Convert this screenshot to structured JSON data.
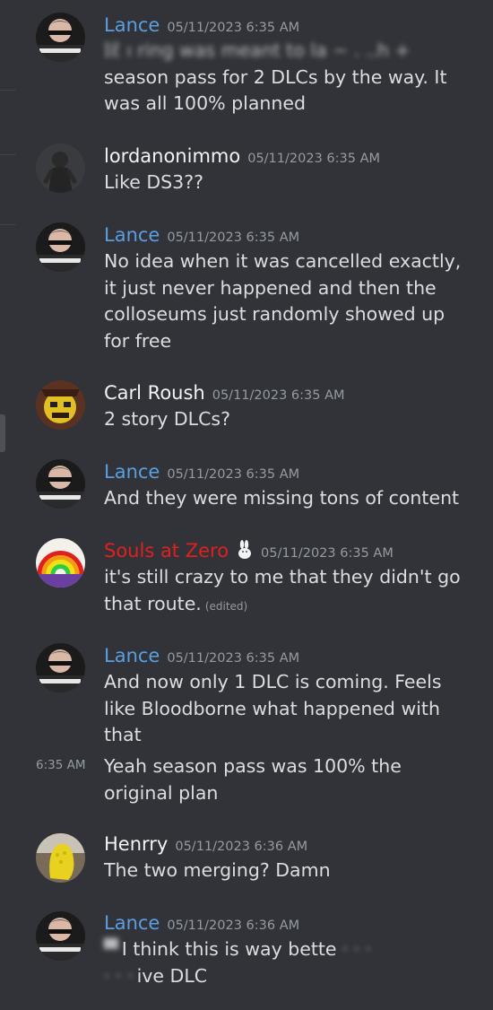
{
  "colors": {
    "background": "#313338",
    "lance": "#5a9fe0",
    "souls": "#e0201f",
    "default_name": "#f2f3f5",
    "timestamp": "#949ba4"
  },
  "messages": [
    {
      "author": "Lance",
      "timestamp": "05/11/2023 6:35 AM",
      "avatar": "anime-character-avatar",
      "lines": [
        "ɪ̃ɛ̃ ı ring was meant to la ~ . ..h +",
        "season pass for 2 DLCs by the way. It",
        "was all 100% planned"
      ]
    },
    {
      "author": "lordanonimmo",
      "timestamp": "05/11/2023 6:35 AM",
      "avatar": "dark-figure-avatar",
      "lines": [
        "Like DS3??"
      ]
    },
    {
      "author": "Lance",
      "timestamp": "05/11/2023 6:35 AM",
      "avatar": "anime-character-avatar",
      "lines": [
        "No idea when it was cancelled exactly,",
        "it just never happened and then the",
        "colloseums just randomly showed up",
        "for free"
      ]
    },
    {
      "author": "Carl Roush",
      "timestamp": "05/11/2023 6:35 AM",
      "avatar": "yellow-face-avatar",
      "lines": [
        "2 story DLCs?"
      ]
    },
    {
      "author": "Lance",
      "timestamp": "05/11/2023 6:35 AM",
      "avatar": "anime-character-avatar",
      "lines": [
        "And they were missing tons of content"
      ]
    },
    {
      "author": "Souls at Zero",
      "timestamp": "05/11/2023 6:35 AM",
      "avatar": "rainbow-avatar",
      "badge": "rabbit-icon",
      "lines": [
        "it's still crazy to me that they didn't go",
        "that route."
      ],
      "edited": "(edited)"
    },
    {
      "author": "Lance",
      "timestamp": "05/11/2023 6:35 AM",
      "avatar": "anime-character-avatar",
      "lines": [
        "And now only 1 DLC is coming. Feels",
        "like Bloodborne what happened with",
        "that"
      ],
      "followup": {
        "time": "6:35 AM",
        "lines": [
          "Yeah season pass was 100% the",
          "original plan"
        ]
      }
    },
    {
      "author": "Henrry",
      "timestamp": "05/11/2023 6:36 AM",
      "avatar": "yellow-shoe-avatar",
      "lines": [
        "The two merging? Damn"
      ]
    },
    {
      "author": "Lance",
      "timestamp": "05/11/2023 6:36 AM",
      "avatar": "anime-character-avatar",
      "lines": [
        "I think this is way bette",
        "ive DLC"
      ]
    }
  ]
}
